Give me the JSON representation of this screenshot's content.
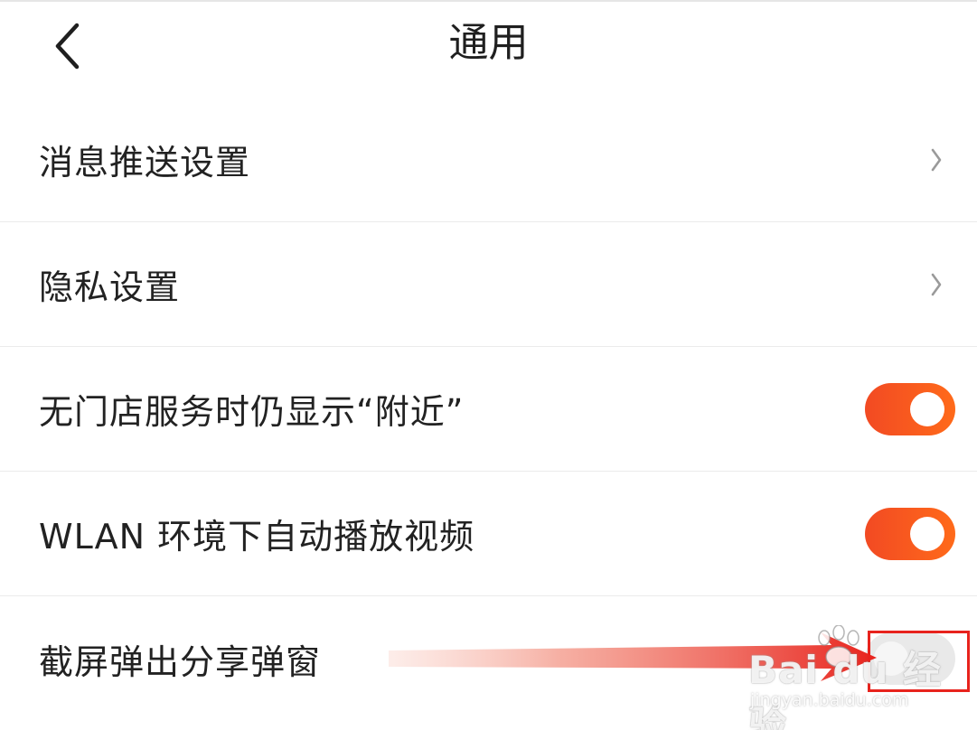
{
  "header": {
    "title": "通用",
    "back_icon": "chevron-left-icon"
  },
  "settings": [
    {
      "label": "消息推送设置",
      "control": "chevron",
      "icon": "chevron-right-icon"
    },
    {
      "label": "隐私设置",
      "control": "chevron",
      "icon": "chevron-right-icon"
    },
    {
      "label": "无门店服务时仍显示“附近”",
      "control": "toggle",
      "state": "on"
    },
    {
      "label": "WLAN 环境下自动播放视频",
      "control": "toggle",
      "state": "on"
    },
    {
      "label": "截屏弹出分享弹窗",
      "control": "toggle",
      "state": "off"
    }
  ],
  "watermark": {
    "logo": "Bai du 经验",
    "url": "jingyan.baidu.com"
  },
  "colors": {
    "toggle_on": "#f24a23",
    "toggle_off": "#e9e9e9",
    "annotation": "#e8231d"
  }
}
